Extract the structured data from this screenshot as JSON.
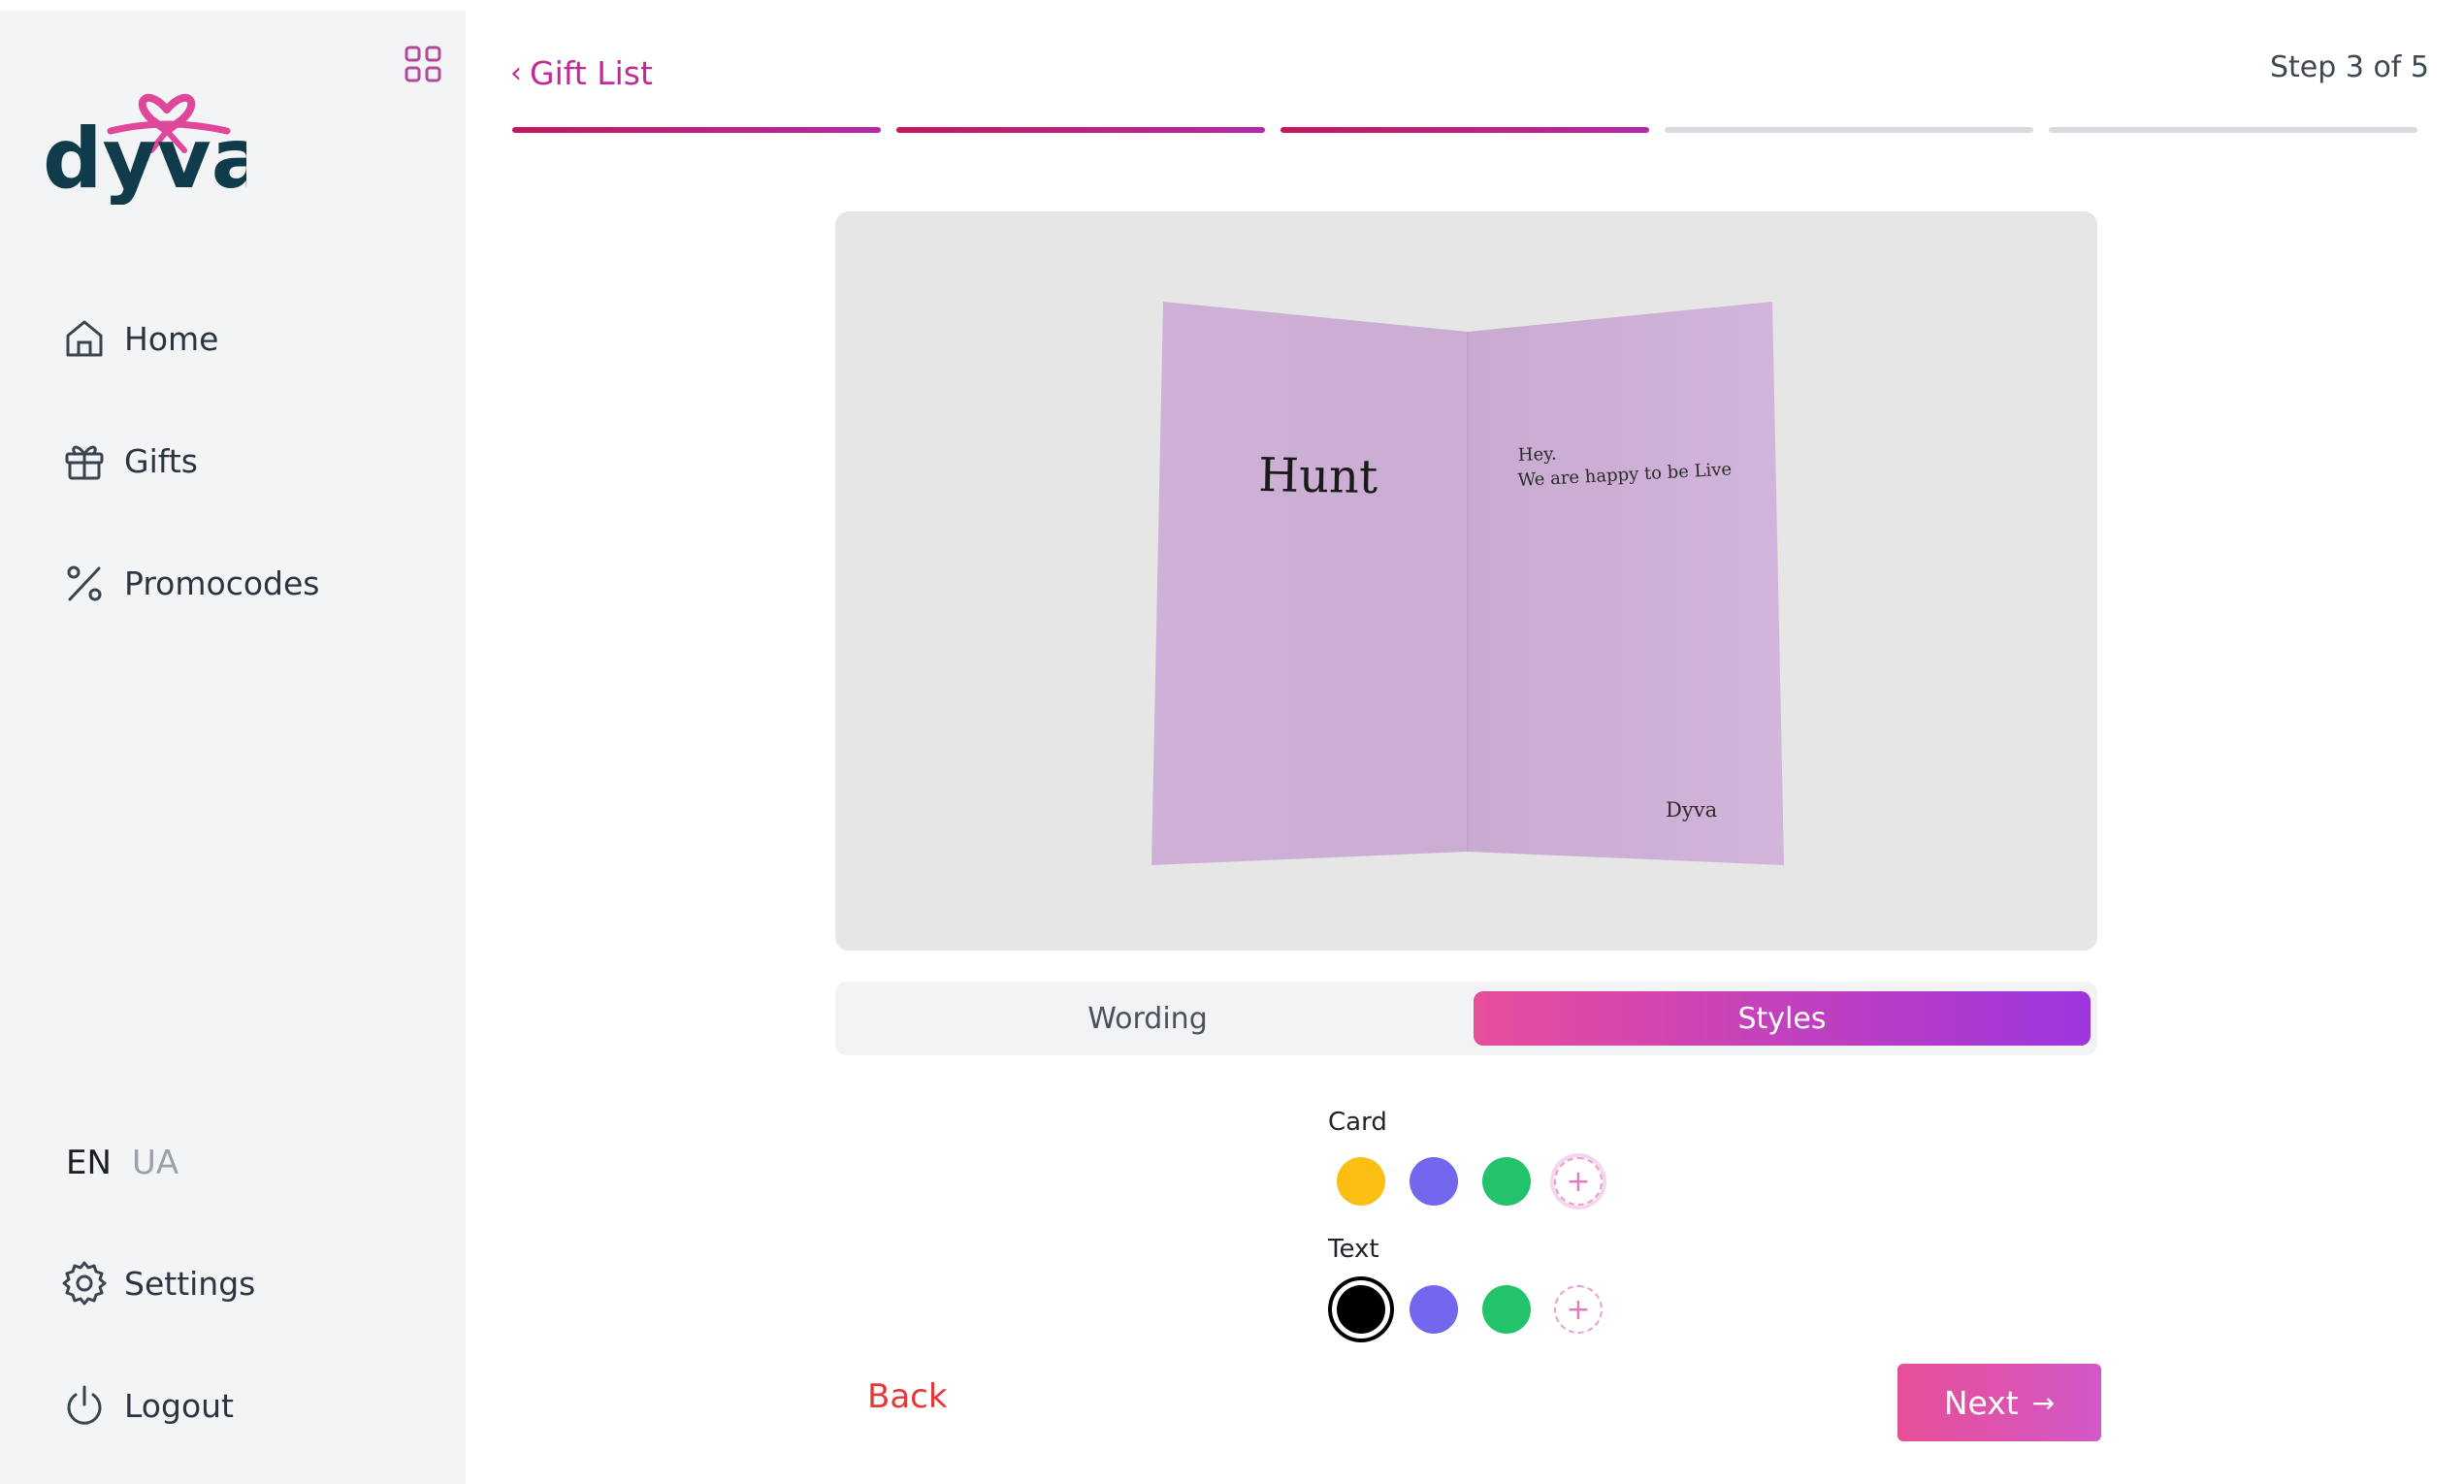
{
  "brand": {
    "name": "dyva",
    "color": "#0f3b4a",
    "accent": "#e0479a"
  },
  "sidebar": {
    "toggle_icon": "grid-icon",
    "nav": [
      {
        "label": "Home",
        "icon": "home-icon"
      },
      {
        "label": "Gifts",
        "icon": "gift-icon"
      },
      {
        "label": "Promocodes",
        "icon": "percent-icon"
      }
    ],
    "languages": {
      "active": "EN",
      "other": "UA"
    },
    "settings_label": "Settings",
    "logout_label": "Logout"
  },
  "header": {
    "back_label": "Gift List",
    "step_text": "Step 3 of 5",
    "progress": {
      "current": 3,
      "total": 5
    }
  },
  "card_preview": {
    "front_title": "Hunt",
    "message_line1": "Hey.",
    "message_line2": "We are happy to be Live",
    "signature": "Dyva",
    "card_color": "#cfb0d6"
  },
  "tabs": {
    "wording": "Wording",
    "styles": "Styles",
    "active": "Styles"
  },
  "styles": {
    "card_label": "Card",
    "card_colors": [
      "#fbbf14",
      "#7367ee",
      "#22c36b"
    ],
    "text_label": "Text",
    "text_colors": [
      "#000000",
      "#7367ee",
      "#22c36b"
    ],
    "text_selected": "#000000"
  },
  "footer": {
    "back_label": "Back",
    "next_label": "Next"
  }
}
